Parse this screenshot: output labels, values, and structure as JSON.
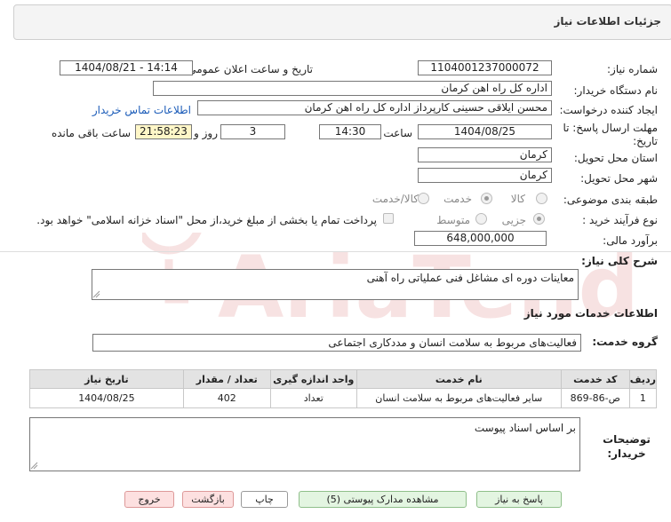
{
  "header": {
    "title": "جزئیات اطلاعات نیاز"
  },
  "fields": {
    "need_number_label": "شماره نیاز:",
    "need_number": "1104001237000072",
    "announce_label": "تاریخ و ساعت اعلان عمومی:",
    "announce_value": "1404/08/21 - 14:14",
    "buyer_org_label": "نام دستگاه خریدار:",
    "buyer_org": "اداره کل راه اهن کرمان",
    "creator_label": "ایجاد کننده درخواست:",
    "creator": "محسن ایلاقی حسینی کارپرداز اداره کل راه اهن کرمان",
    "contact_link": "اطلاعات تماس خریدار",
    "deadline_label": "مهلت ارسال پاسخ: تا تاریخ:",
    "deadline_date": "1404/08/25",
    "time_label": "ساعت",
    "deadline_time": "14:30",
    "days_value": "3",
    "days_label": "روز و",
    "remaining_time": "21:58:23",
    "remaining_label": "ساعت باقی مانده",
    "province_label": "استان محل تحویل:",
    "province": "کرمان",
    "city_label": "شهر محل تحویل:",
    "city": "کرمان",
    "category_label": "طبقه بندی موضوعی:",
    "category_options": [
      "کالا",
      "خدمت",
      "کالا/خدمت"
    ],
    "category_selected": "خدمت",
    "process_label": "نوع فرآیند خرید :",
    "process_options": [
      "جزیی",
      "متوسط"
    ],
    "process_selected": "جزیی",
    "treasury_note": "پرداخت تمام یا بخشی از مبلغ خرید،از محل \"اسناد خزانه اسلامی\" خواهد بود.",
    "budget_label": "برآورد مالی:",
    "budget": "648,000,000"
  },
  "description": {
    "label": "شرح کلی نیاز:",
    "value": "معاینات دوره ای مشاغل فنی عملیاتی راه آهنی"
  },
  "services": {
    "section_title": "اطلاعات خدمات مورد نیاز",
    "group_label": "گروه خدمت:",
    "group_value": "فعالیت‌های مربوط به سلامت انسان و مددکاری اجتماعی",
    "table": {
      "headers": [
        "ردیف",
        "کد خدمت",
        "نام خدمت",
        "واحد اندازه گیری",
        "تعداد / مقدار",
        "تاریخ نیاز"
      ],
      "rows": [
        [
          "1",
          "ص-86-869",
          "سایر فعالیت‌های مربوط به سلامت انسان",
          "تعداد",
          "402",
          "1404/08/25"
        ]
      ]
    }
  },
  "buyer_notes": {
    "label": "توضیحات خریدار:",
    "value": "بر اساس اسناد پیوست"
  },
  "buttons": {
    "reply": "پاسخ به نیاز",
    "view_docs": "مشاهده مدارک پیوستی (5)",
    "print": "چاپ",
    "back": "بازگشت",
    "exit": "خروج"
  },
  "colors": {
    "header_bg": "#f4f4f4",
    "time_highlight": "#fff7c8",
    "link": "#1a5bb8",
    "green_button": "#e3f5e1",
    "pink_button": "#fde0e0",
    "watermark": "#c62828"
  }
}
